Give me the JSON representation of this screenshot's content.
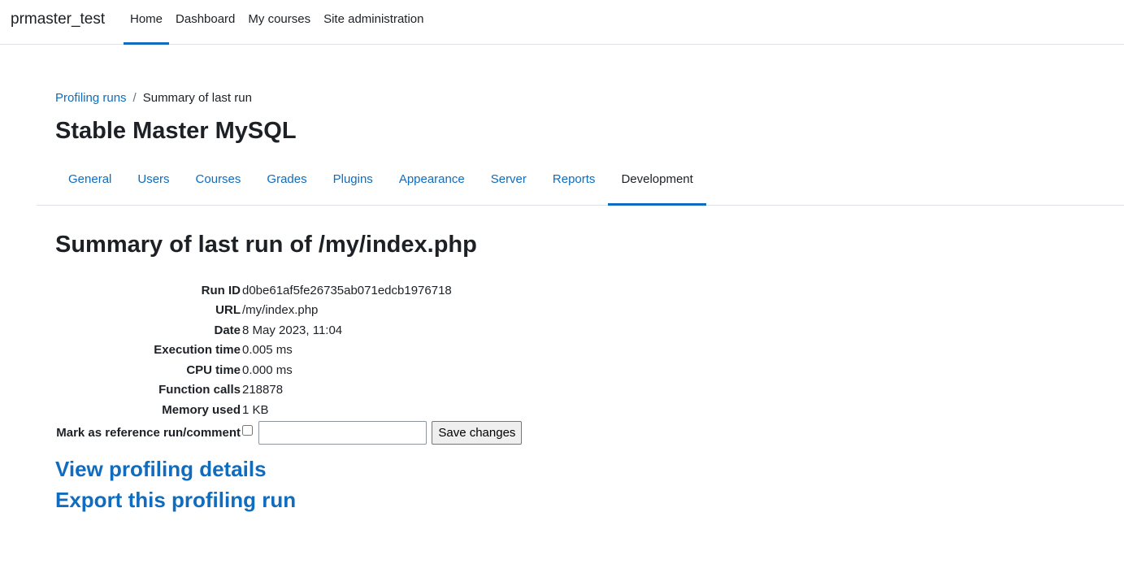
{
  "navbar": {
    "brand": "prmaster_test",
    "items": [
      {
        "label": "Home",
        "active": true
      },
      {
        "label": "Dashboard"
      },
      {
        "label": "My courses"
      },
      {
        "label": "Site administration"
      }
    ]
  },
  "breadcrumb": {
    "parent": "Profiling runs",
    "separator": "/",
    "current": "Summary of last run"
  },
  "page_title": "Stable Master MySQL",
  "tabs": [
    {
      "label": "General"
    },
    {
      "label": "Users"
    },
    {
      "label": "Courses"
    },
    {
      "label": "Grades"
    },
    {
      "label": "Plugins"
    },
    {
      "label": "Appearance"
    },
    {
      "label": "Server"
    },
    {
      "label": "Reports"
    },
    {
      "label": "Development",
      "active": true
    }
  ],
  "summary": {
    "heading": "Summary of last run of /my/index.php",
    "rows": [
      {
        "label": "Run ID",
        "value": "d0be61af5fe26735ab071edcb1976718"
      },
      {
        "label": "URL",
        "value": "/my/index.php"
      },
      {
        "label": "Date",
        "value": "8 May 2023, 11:04"
      },
      {
        "label": "Execution time",
        "value": "0.005 ms"
      },
      {
        "label": "CPU time",
        "value": "0.000 ms"
      },
      {
        "label": "Function calls",
        "value": "218878"
      },
      {
        "label": "Memory used",
        "value": "1 KB"
      }
    ],
    "reference": {
      "label": "Mark as reference run/comment",
      "checked": false,
      "comment_value": "",
      "save_label": "Save changes"
    }
  },
  "links": {
    "view_details": "View profiling details",
    "export": "Export this profiling run"
  },
  "colors": {
    "link": "#0f6cbf",
    "text": "#1d2125",
    "border": "#dee2e6"
  }
}
